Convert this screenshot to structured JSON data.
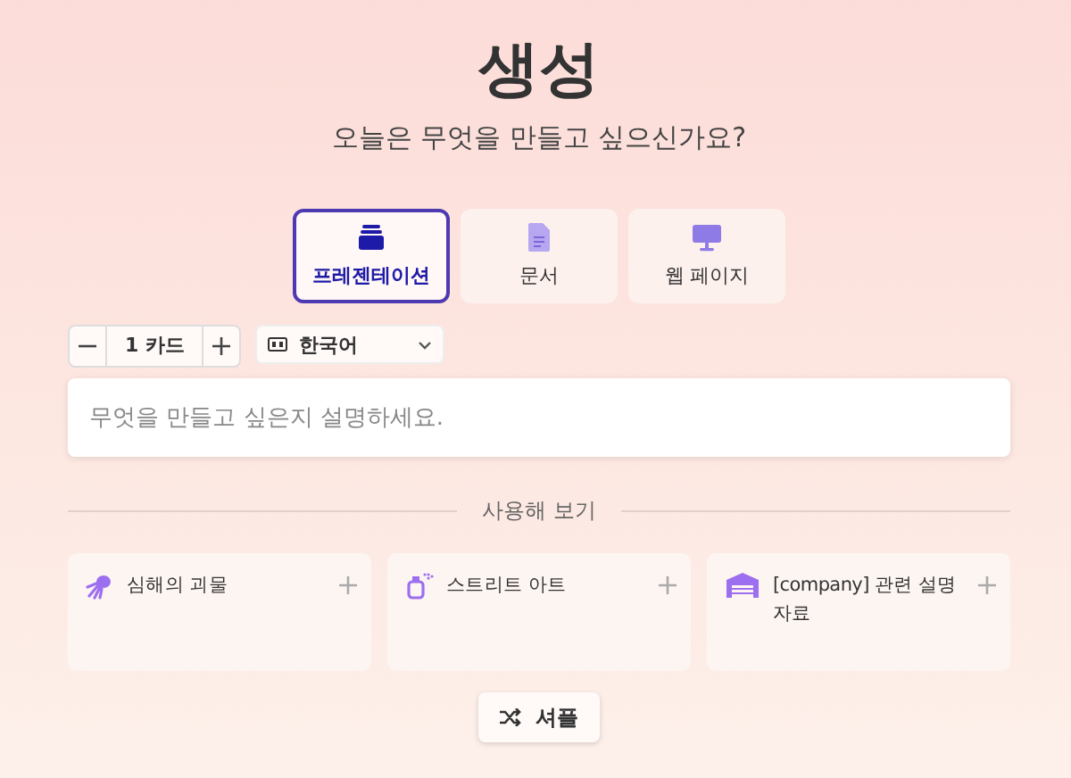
{
  "title": "생성",
  "subtitle": "오늘은 무엇을 만들고 싶으신가요?",
  "types": [
    {
      "kind": "presentation",
      "label": "프레젠테이션",
      "selected": true
    },
    {
      "kind": "document",
      "label": "문서",
      "selected": false
    },
    {
      "kind": "webpage",
      "label": "웹 페이지",
      "selected": false
    }
  ],
  "card_count": {
    "value": "1 카드"
  },
  "language": {
    "value": "한국어"
  },
  "prompt": {
    "placeholder": "무엇을 만들고 싶은지 설명하세요."
  },
  "divider_label": "사용해 보기",
  "examples": [
    {
      "kind": "creature",
      "label": "심해의 괴물"
    },
    {
      "kind": "spray",
      "label": "스트리트 아트"
    },
    {
      "kind": "warehouse",
      "label": "[company] 관련 설명 자료"
    }
  ],
  "shuffle_button": "셔플"
}
